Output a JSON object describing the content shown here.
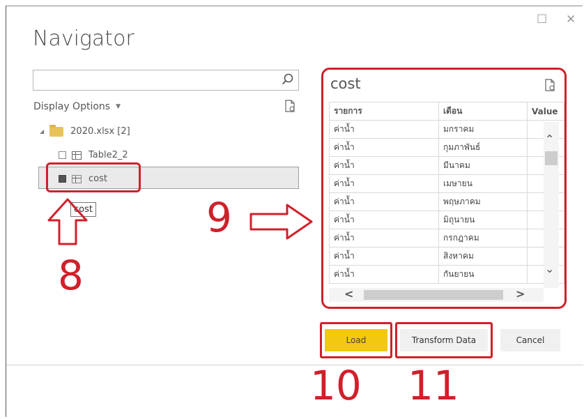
{
  "window": {
    "title": "Navigator",
    "maximize_glyph": "☐",
    "close_glyph": "✕"
  },
  "search": {
    "placeholder": "",
    "value": "",
    "icon": "search-icon"
  },
  "display_options": {
    "label": "Display Options"
  },
  "tree": {
    "folder": {
      "label": "2020.xlsx [2]",
      "icon": "folder-icon"
    },
    "items": [
      {
        "label": "Table2_2",
        "checked": false,
        "icon": "table-icon"
      },
      {
        "label": "cost",
        "checked": true,
        "icon": "sheet-icon"
      }
    ],
    "tooltip": "cost"
  },
  "preview": {
    "title": "cost",
    "columns": [
      "รายการ",
      "เดือน",
      "Value"
    ],
    "rows": [
      [
        "ค่าน้ำ",
        "มกราคม"
      ],
      [
        "ค่าน้ำ",
        "กุมภาพันธ์"
      ],
      [
        "ค่าน้ำ",
        "มีนาคม"
      ],
      [
        "ค่าน้ำ",
        "เมษายน"
      ],
      [
        "ค่าน้ำ",
        "พฤษภาคม"
      ],
      [
        "ค่าน้ำ",
        "มิถุนายน"
      ],
      [
        "ค่าน้ำ",
        "กรกฎาคม"
      ],
      [
        "ค่าน้ำ",
        "สิงหาคม"
      ],
      [
        "ค่าน้ำ",
        "กันยายน"
      ]
    ]
  },
  "buttons": {
    "load": "Load",
    "transform": "Transform Data",
    "cancel": "Cancel"
  },
  "annotations": {
    "n8": "8",
    "n9": "9",
    "n10": "10",
    "n11": "11"
  },
  "colors": {
    "accent_red": "#d0202a",
    "load_yellow": "#f2c811",
    "folder_gold": "#e8c25a"
  }
}
